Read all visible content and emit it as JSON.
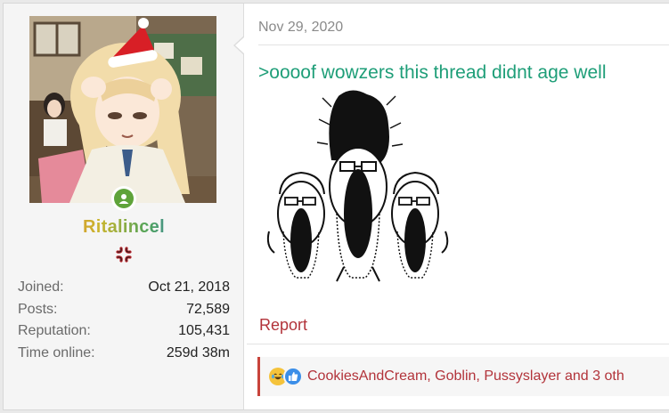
{
  "post": {
    "date": "Nov 29, 2020",
    "message": ">oooof wowzers this thread didnt age well",
    "report_label": "Report",
    "reactions_text": "CookiesAndCream, Goblin, Pussyslayer and 3 oth",
    "reaction_icons": [
      "laughing-crying-icon",
      "thumbs-up-icon"
    ]
  },
  "user": {
    "username": "Ritalincel",
    "avatar": "anime-girl-santa-hat-avatar",
    "status": "online",
    "stats": [
      {
        "label": "Joined:",
        "value": "Oct 21, 2018"
      },
      {
        "label": "Posts:",
        "value": "72,589"
      },
      {
        "label": "Reputation:",
        "value": "105,431"
      },
      {
        "label": "Time online:",
        "value": "259d 38m"
      }
    ]
  },
  "colors": {
    "greentext": "#1e9e78",
    "link_red": "#b2333a",
    "online_green": "#5fa33a",
    "reaction_bar_accent": "#c8433b"
  }
}
